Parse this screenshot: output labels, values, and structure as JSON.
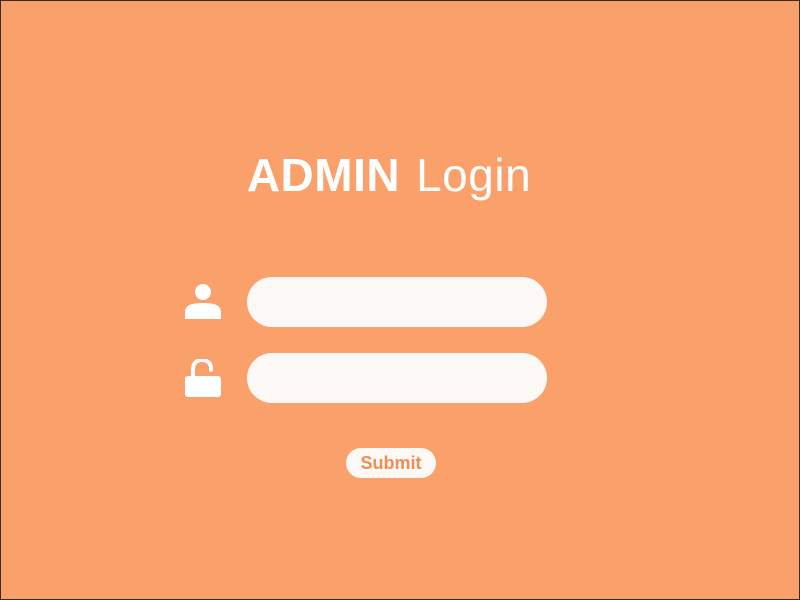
{
  "colors": {
    "background": "#F9A06B",
    "foreground": "#FFFFFF",
    "field_fill": "#FCF8F6",
    "button_text": "#F18C52"
  },
  "header": {
    "title_strong": "ADMIN",
    "title_light": "Login"
  },
  "form": {
    "username": {
      "icon": "user-icon",
      "value": "",
      "placeholder": ""
    },
    "password": {
      "icon": "unlock-icon",
      "value": "",
      "placeholder": ""
    },
    "submit_label": "Submit"
  }
}
